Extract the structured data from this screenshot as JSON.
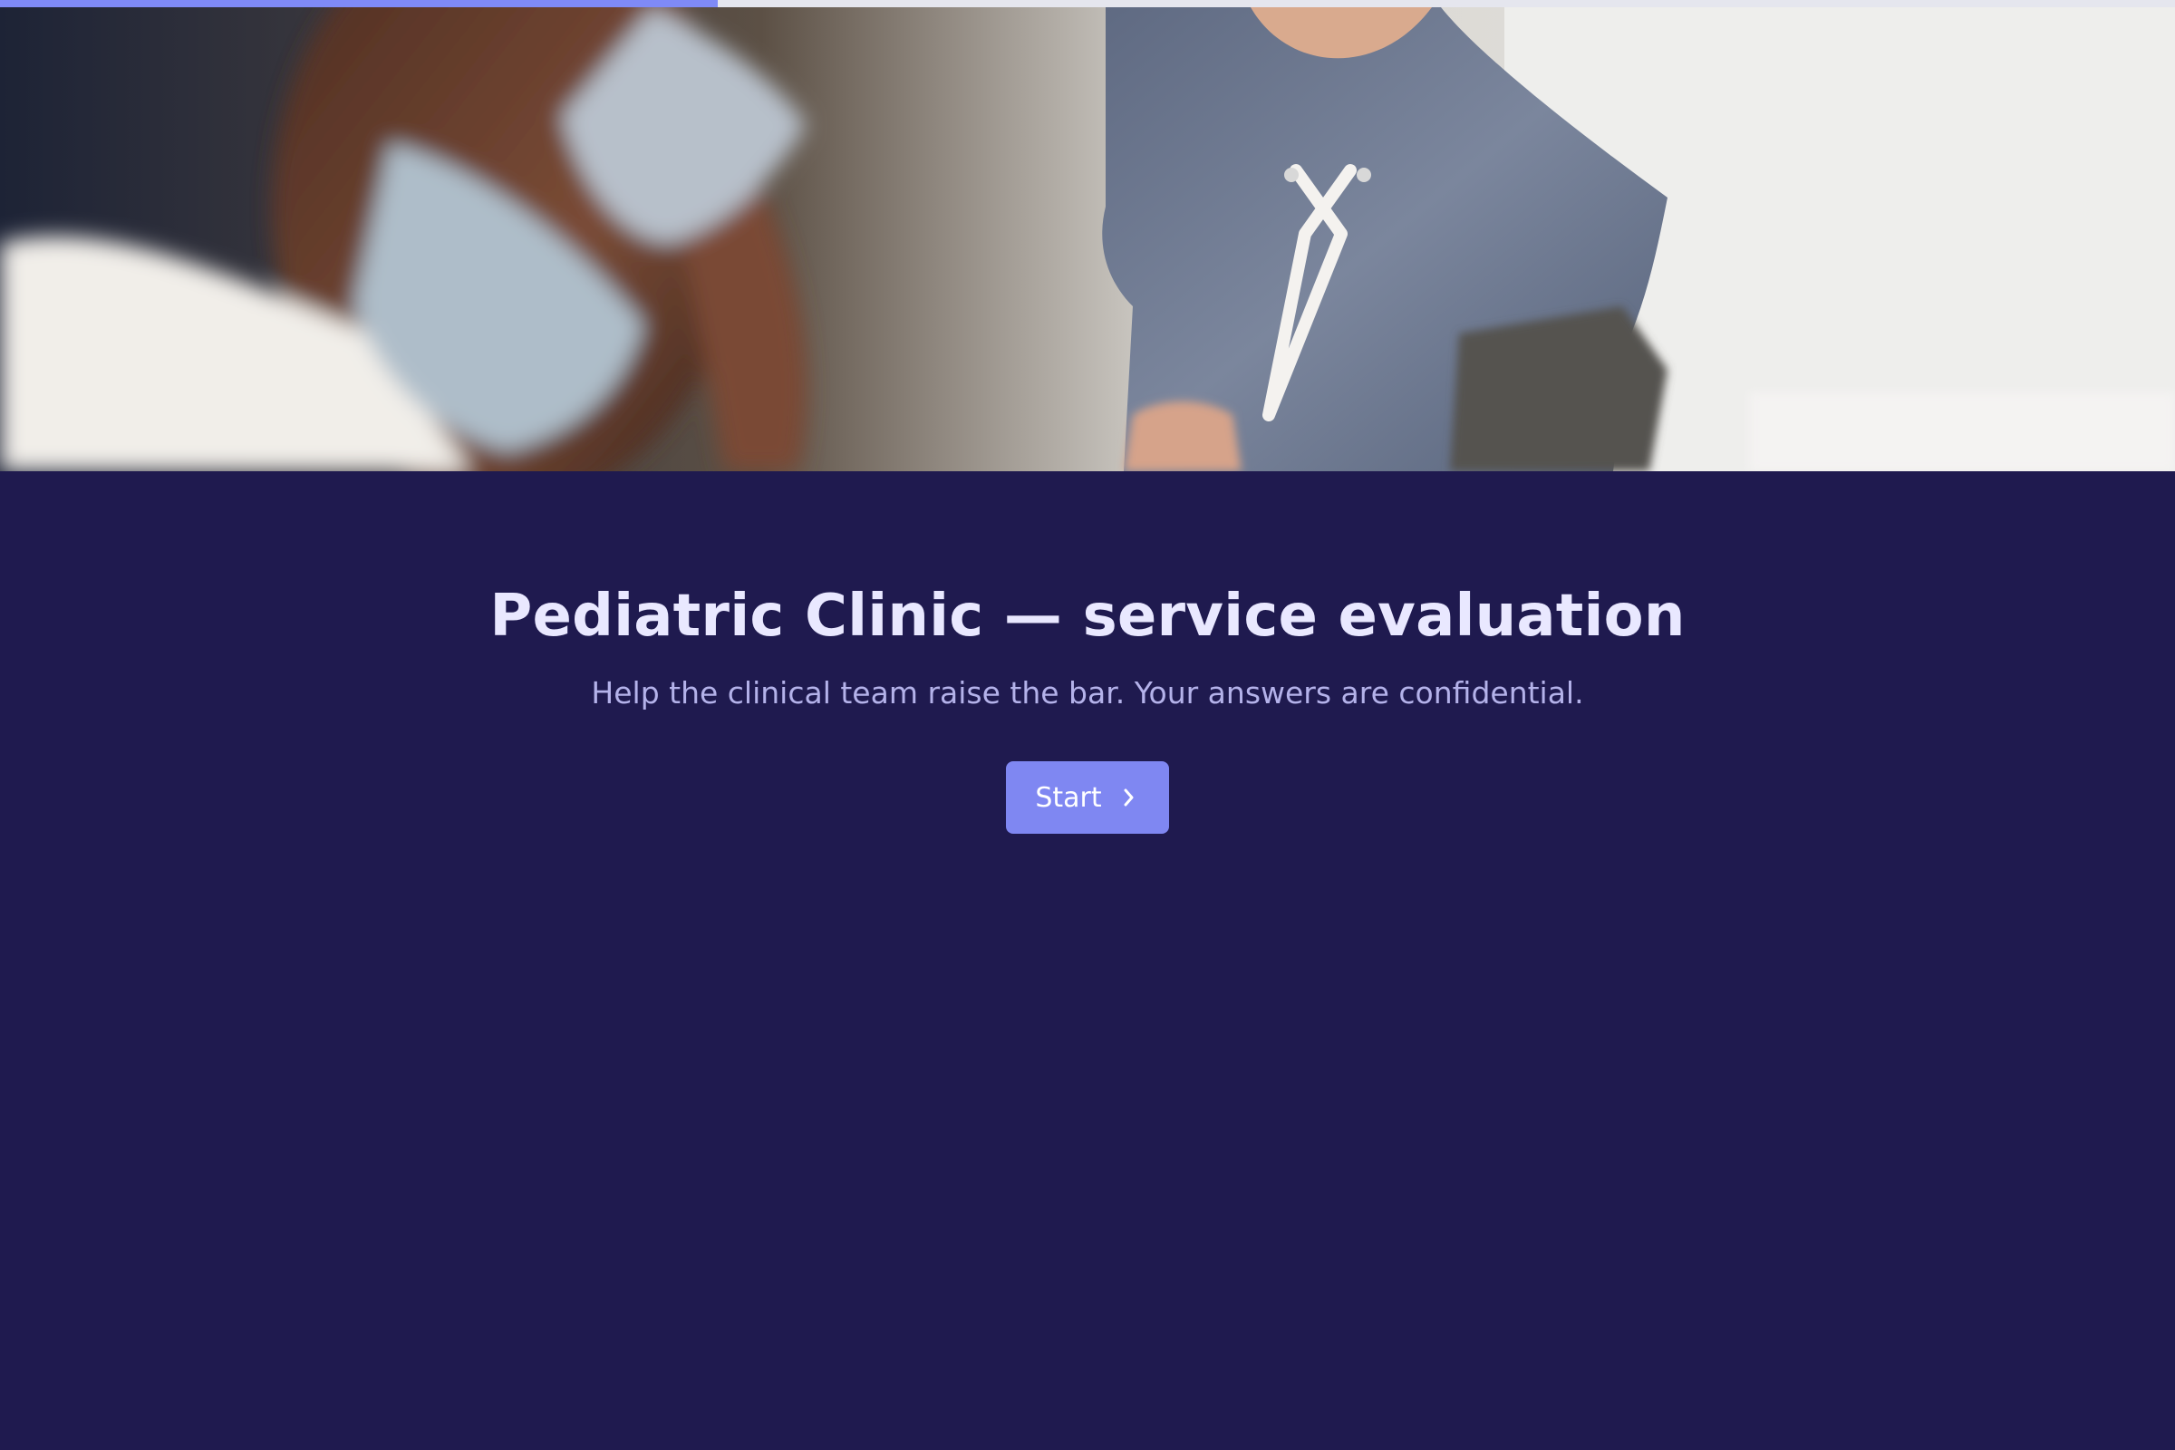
{
  "progress": {
    "value_fraction": 0.33,
    "fill_color": "#7f8af7",
    "track_color": "#e5e6ee"
  },
  "hero": {
    "image_description": "Blurred photo of a masked clinician beside a child in a gray lace-up t-shirt"
  },
  "intro": {
    "title": "Pediatric Clinic — service evaluation",
    "subtitle": "Help the clinical team raise the bar. Your answers are confidential.",
    "start_button_label": "Start",
    "start_button_icon": "chevron-right-icon"
  },
  "colors": {
    "background": "#1f1a4f",
    "title": "#e9e8ff",
    "subtitle": "#b4b2ea",
    "button": "#7f87f2",
    "button_text": "#ffffff"
  }
}
